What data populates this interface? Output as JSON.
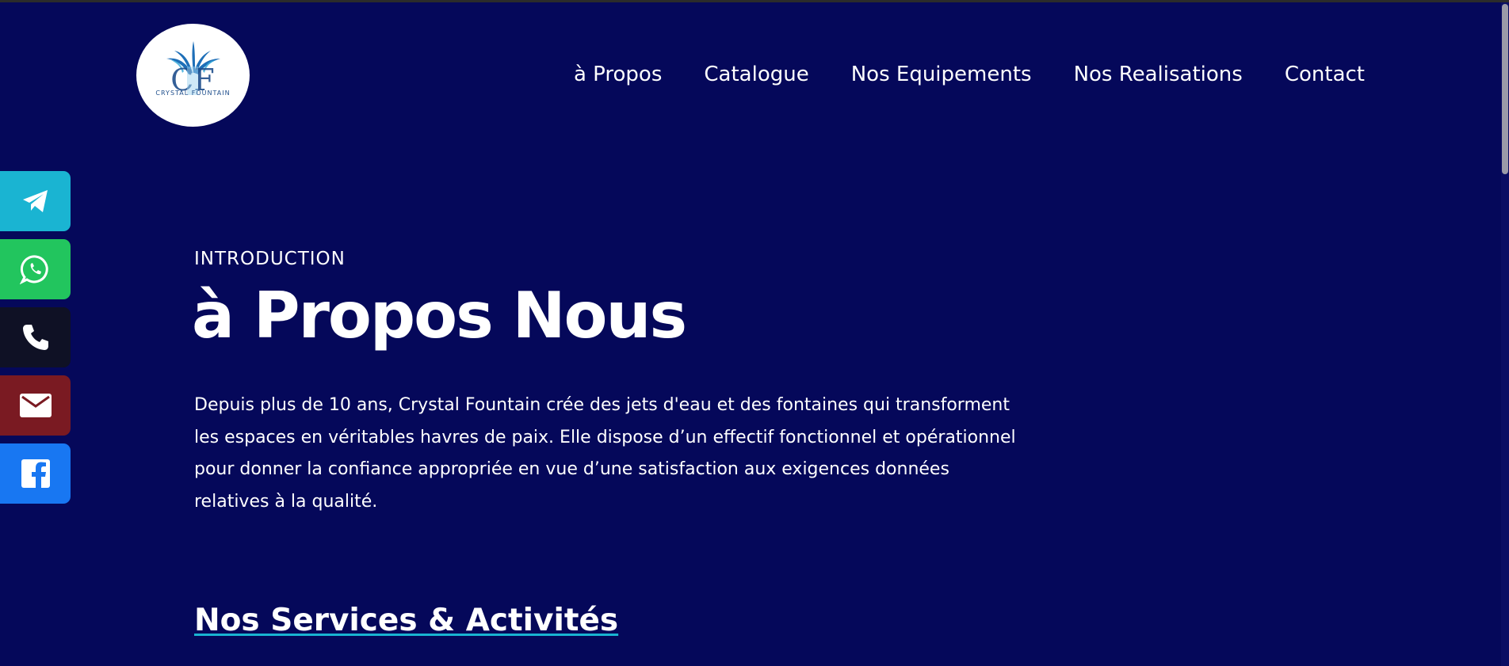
{
  "header": {
    "logo_text": "CRYSTAL FOUNTAIN",
    "nav": [
      {
        "label": "à Propos"
      },
      {
        "label": "Catalogue"
      },
      {
        "label": "Nos Equipements"
      },
      {
        "label": "Nos Realisations"
      },
      {
        "label": "Contact"
      }
    ]
  },
  "social": [
    {
      "icon": "telegram-icon",
      "color": "#1ab4d2"
    },
    {
      "icon": "whatsapp-icon",
      "color": "#22c55e"
    },
    {
      "icon": "phone-icon",
      "color": "#0f1125"
    },
    {
      "icon": "email-icon",
      "color": "#7a1a22"
    },
    {
      "icon": "facebook-icon",
      "color": "#1877f2"
    }
  ],
  "intro": {
    "kicker": "INTRODUCTION",
    "title": "à Propos Nous",
    "text": "Depuis plus de 10 ans, Crystal Fountain crée des jets d'eau et des fontaines qui transforment les espaces en véritables havres de paix. Elle dispose d’un effectif fonctionnel et opérationnel pour donner la confiance appropriée en vue d’une satisfaction aux exigences données relatives à la qualité."
  },
  "services": {
    "title": "Nos Services & Activités"
  },
  "colors": {
    "background": "#05085a",
    "accent_underline": "#19b4d2",
    "text": "#ffffff"
  }
}
